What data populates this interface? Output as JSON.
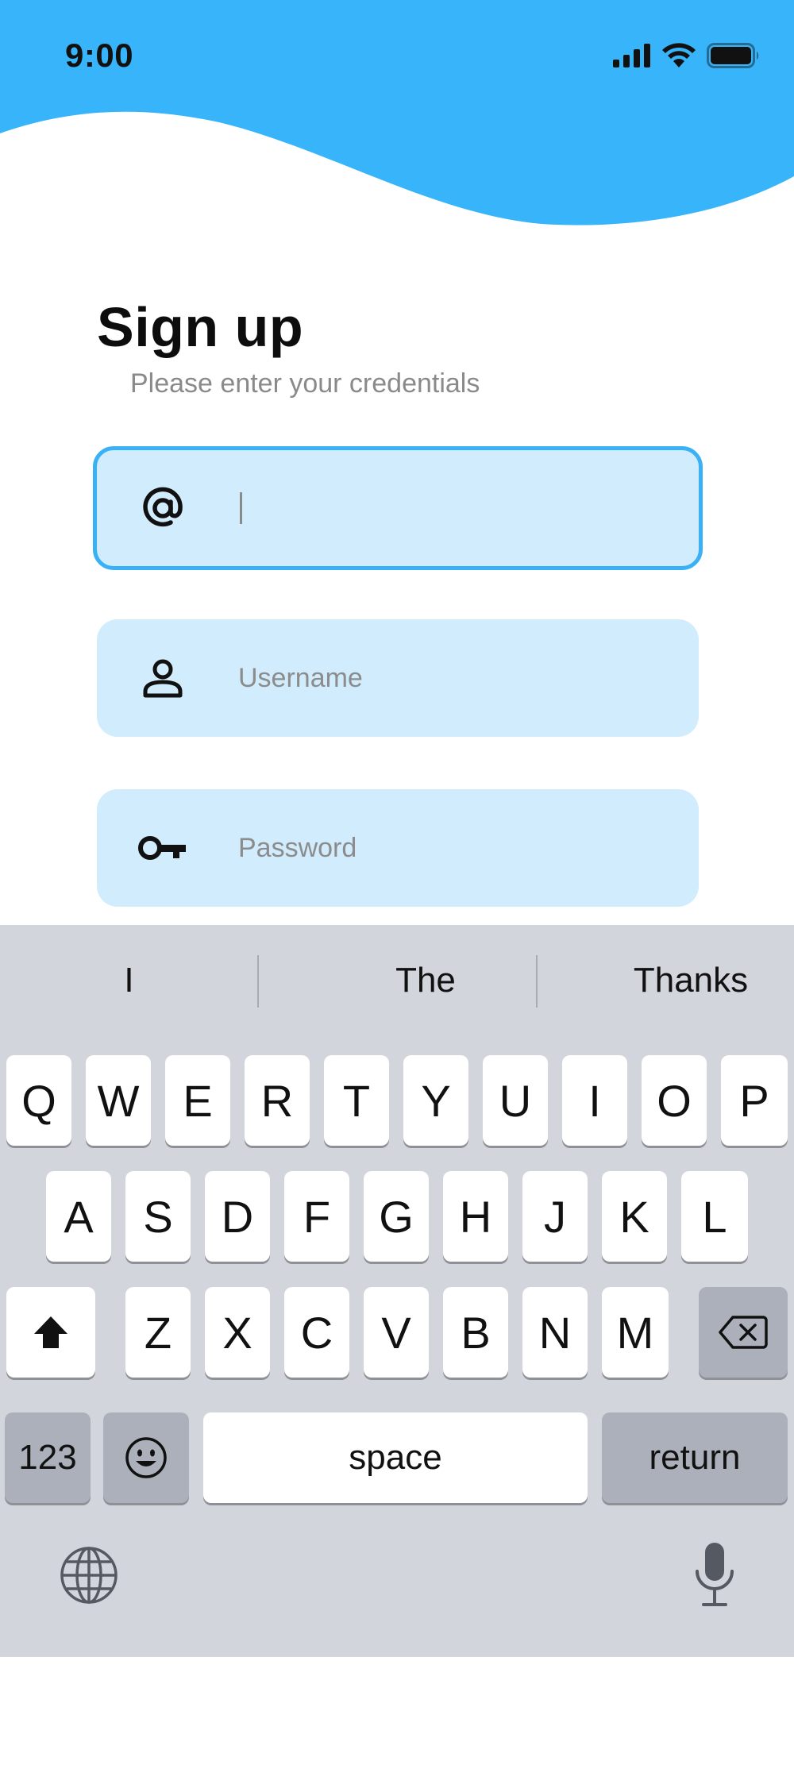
{
  "colors": {
    "accent": "#38b4fb",
    "field_bg": "#d1ecfc",
    "focus_border": "#3bb1f5",
    "keyboard_bg": "#d2d5db"
  },
  "status_bar": {
    "time": "9:00",
    "icons": [
      "cellular-signal-icon",
      "wifi-icon",
      "battery-icon"
    ]
  },
  "form": {
    "title": "Sign up",
    "subtitle": "Please enter your credentials",
    "fields": [
      {
        "icon": "at-sign-icon",
        "value": "",
        "placeholder": "",
        "focused": true
      },
      {
        "icon": "user-icon",
        "value": "",
        "placeholder": "Username",
        "focused": false
      },
      {
        "icon": "key-icon",
        "value": "",
        "placeholder": "Password",
        "focused": false
      }
    ]
  },
  "keyboard": {
    "suggestions": [
      "I",
      "The",
      "Thanks"
    ],
    "row1": [
      "Q",
      "W",
      "E",
      "R",
      "T",
      "Y",
      "U",
      "I",
      "O",
      "P"
    ],
    "row2": [
      "A",
      "S",
      "D",
      "F",
      "G",
      "H",
      "J",
      "K",
      "L"
    ],
    "row3": [
      "Z",
      "X",
      "C",
      "V",
      "B",
      "N",
      "M"
    ],
    "numbers_label": "123",
    "space_label": "space",
    "return_label": "return",
    "icons": [
      "shift-icon",
      "backspace-icon",
      "emoji-icon",
      "globe-icon",
      "microphone-icon"
    ]
  }
}
